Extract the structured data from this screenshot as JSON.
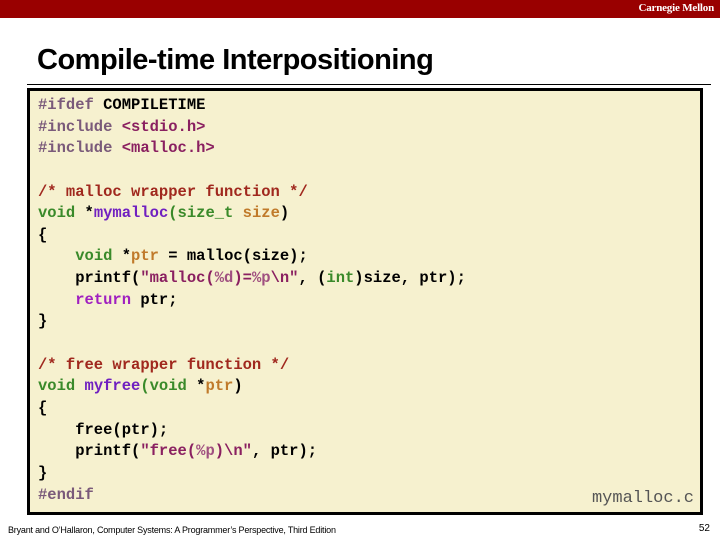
{
  "header": {
    "brand": "Carnegie Mellon",
    "bar_color": "#990000"
  },
  "slide": {
    "title": "Compile-time Interpositioning",
    "filename": "mymalloc.c",
    "footer": "Bryant and O’Hallaron, Computer Systems: A Programmer’s Perspective, Third Edition",
    "page_number": "52"
  },
  "code_colors": {
    "background": "#f6f1cf",
    "preprocessor": "#7a5a7a",
    "header_string": "#8a2060",
    "comment": "#a0281e",
    "type_keyword": "#3a8a2a",
    "function_name": "#7020c0",
    "identifier": "#c07a2a",
    "string": "#8a2060",
    "return_keyword": "#a020c0"
  },
  "code_lines": [
    [
      {
        "t": "#ifdef ",
        "c": "pp"
      },
      {
        "t": "COMPILETIME",
        "c": ""
      }
    ],
    [
      {
        "t": "#include ",
        "c": "pp"
      },
      {
        "t": "<stdio.h>",
        "c": "hdr"
      }
    ],
    [
      {
        "t": "#include ",
        "c": "pp"
      },
      {
        "t": "<malloc.h>",
        "c": "hdr"
      }
    ],
    [],
    [
      {
        "t": "/* malloc wrapper function */",
        "c": "cm"
      }
    ],
    [
      {
        "t": "void ",
        "c": "kw"
      },
      {
        "t": "*",
        "c": ""
      },
      {
        "t": "mymalloc",
        "c": "fn"
      },
      {
        "t": "(size_t ",
        "c": "kw"
      },
      {
        "t": "size",
        "c": "id"
      },
      {
        "t": ")",
        "c": ""
      }
    ],
    [
      {
        "t": "{",
        "c": ""
      }
    ],
    [
      {
        "t": "    ",
        "c": ""
      },
      {
        "t": "void ",
        "c": "kw"
      },
      {
        "t": "*",
        "c": ""
      },
      {
        "t": "ptr",
        "c": "id"
      },
      {
        "t": " = malloc(size);",
        "c": ""
      }
    ],
    [
      {
        "t": "    printf(",
        "c": ""
      },
      {
        "t": "\"malloc(",
        "c": "str"
      },
      {
        "t": "%d",
        "c": "fmt"
      },
      {
        "t": ")=",
        "c": "str"
      },
      {
        "t": "%p",
        "c": "fmt"
      },
      {
        "t": "\\n\"",
        "c": "str"
      },
      {
        "t": ", (",
        "c": ""
      },
      {
        "t": "int",
        "c": "kw"
      },
      {
        "t": ")size, ptr);",
        "c": ""
      }
    ],
    [
      {
        "t": "    ",
        "c": ""
      },
      {
        "t": "return",
        "c": "ret"
      },
      {
        "t": " ptr;",
        "c": ""
      }
    ],
    [
      {
        "t": "}",
        "c": ""
      }
    ],
    [],
    [
      {
        "t": "/* free wrapper function */",
        "c": "cm"
      }
    ],
    [
      {
        "t": "void ",
        "c": "kw"
      },
      {
        "t": "myfree",
        "c": "fn"
      },
      {
        "t": "(void ",
        "c": "kw"
      },
      {
        "t": "*",
        "c": ""
      },
      {
        "t": "ptr",
        "c": "id"
      },
      {
        "t": ")",
        "c": ""
      }
    ],
    [
      {
        "t": "{",
        "c": ""
      }
    ],
    [
      {
        "t": "    free(ptr);",
        "c": ""
      }
    ],
    [
      {
        "t": "    printf(",
        "c": ""
      },
      {
        "t": "\"free(",
        "c": "str"
      },
      {
        "t": "%p",
        "c": "fmt"
      },
      {
        "t": ")\\n\"",
        "c": "str"
      },
      {
        "t": ", ptr);",
        "c": ""
      }
    ],
    [
      {
        "t": "}",
        "c": ""
      }
    ],
    [
      {
        "t": "#endif",
        "c": "pp"
      }
    ]
  ]
}
